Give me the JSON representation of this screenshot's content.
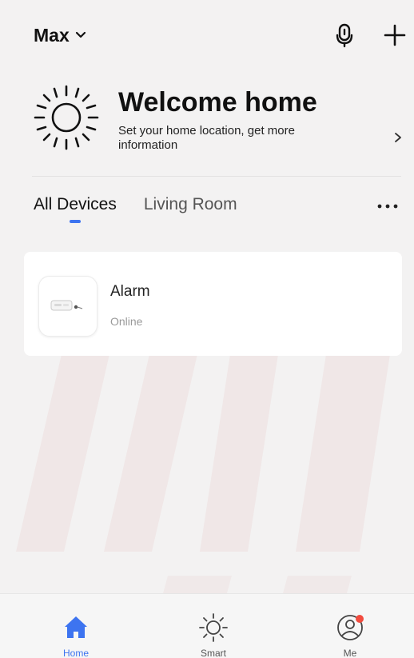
{
  "header": {
    "home_name": "Max",
    "icons": {
      "home_dropdown": "chevron-down-icon",
      "voice": "microphone-icon",
      "add": "plus-icon"
    }
  },
  "welcome": {
    "title": "Welcome home",
    "subtitle": "Set your home location, get more information",
    "icons": {
      "weather": "sun-icon",
      "arrow": "chevron-right-icon"
    }
  },
  "tabs": [
    {
      "label": "All Devices",
      "active": true
    },
    {
      "label": "Living Room",
      "active": false
    }
  ],
  "more_icon": "more-dots-icon",
  "devices": [
    {
      "name": "Alarm",
      "status": "Online",
      "icon": "alarm-device-icon"
    }
  ],
  "bottom_nav": {
    "items": [
      {
        "label": "Home",
        "icon": "home-icon",
        "active": true
      },
      {
        "label": "Smart",
        "icon": "sun-icon",
        "active": false
      },
      {
        "label": "Me",
        "icon": "profile-icon",
        "active": false
      }
    ],
    "me_badge_color": "#f24b3e"
  },
  "colors": {
    "accent": "#3d74f0",
    "background": "#f3f2f2",
    "card": "#ffffff",
    "text_primary": "#111111",
    "text_secondary": "#9a9a9a"
  }
}
